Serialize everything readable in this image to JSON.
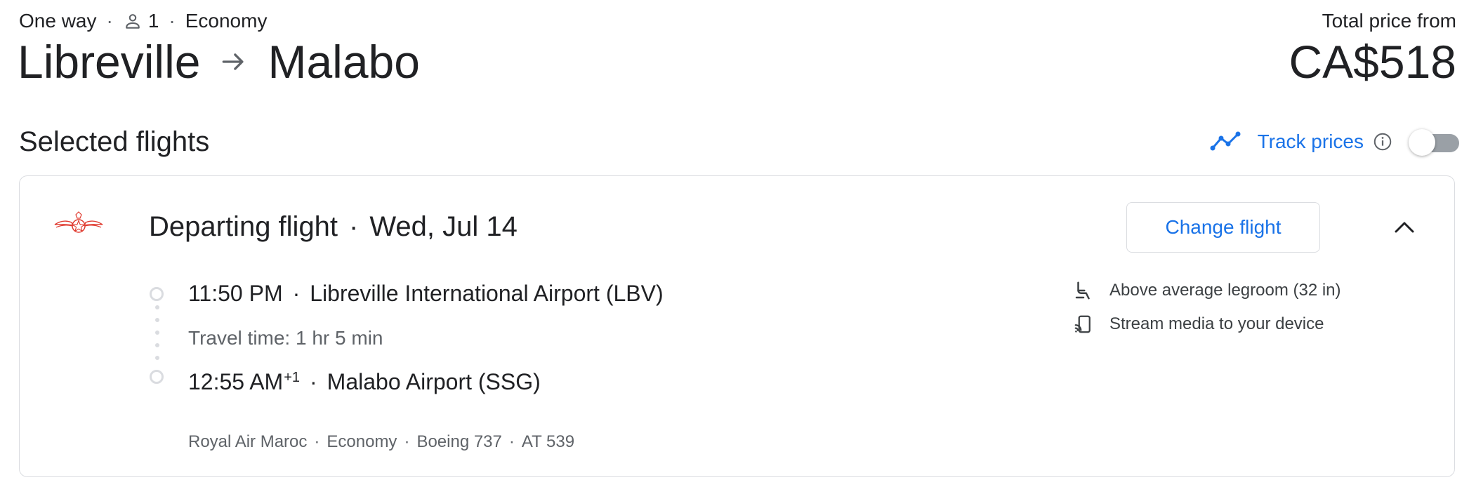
{
  "header": {
    "trip_type": "One way",
    "passengers": "1",
    "cabin_class": "Economy",
    "origin": "Libreville",
    "destination": "Malabo",
    "price_label": "Total price from",
    "price_value": "CA$518"
  },
  "section": {
    "title": "Selected flights",
    "track_prices_label": "Track prices",
    "track_prices_enabled": false
  },
  "flight": {
    "title": "Departing flight",
    "date": "Wed, Jul 14",
    "change_button_label": "Change flight",
    "departure_time": "11:50 PM",
    "departure_airport": "Libreville International Airport (LBV)",
    "travel_time": "Travel time: 1 hr 5 min",
    "arrival_time": "12:55 AM",
    "arrival_day_offset": "+1",
    "arrival_airport": "Malabo Airport (SSG)",
    "airline": "Royal Air Maroc",
    "cabin": "Economy",
    "aircraft": "Boeing 737",
    "flight_number": "AT 539",
    "amenities": [
      {
        "icon": "legroom-icon",
        "label": "Above average legroom (32 in)"
      },
      {
        "icon": "stream-media-icon",
        "label": "Stream media to your device"
      }
    ]
  },
  "icons": {
    "person": "person-icon",
    "arrow": "arrow-right-icon",
    "trend": "trend-icon",
    "info": "info-icon",
    "chevron": "chevron-up-icon",
    "airline_logo": "royal-air-maroc-logo"
  },
  "colors": {
    "accent_blue": "#1a73e8",
    "logo_red": "#e03c31",
    "border": "#dadce0",
    "secondary_text": "#5f6368"
  }
}
